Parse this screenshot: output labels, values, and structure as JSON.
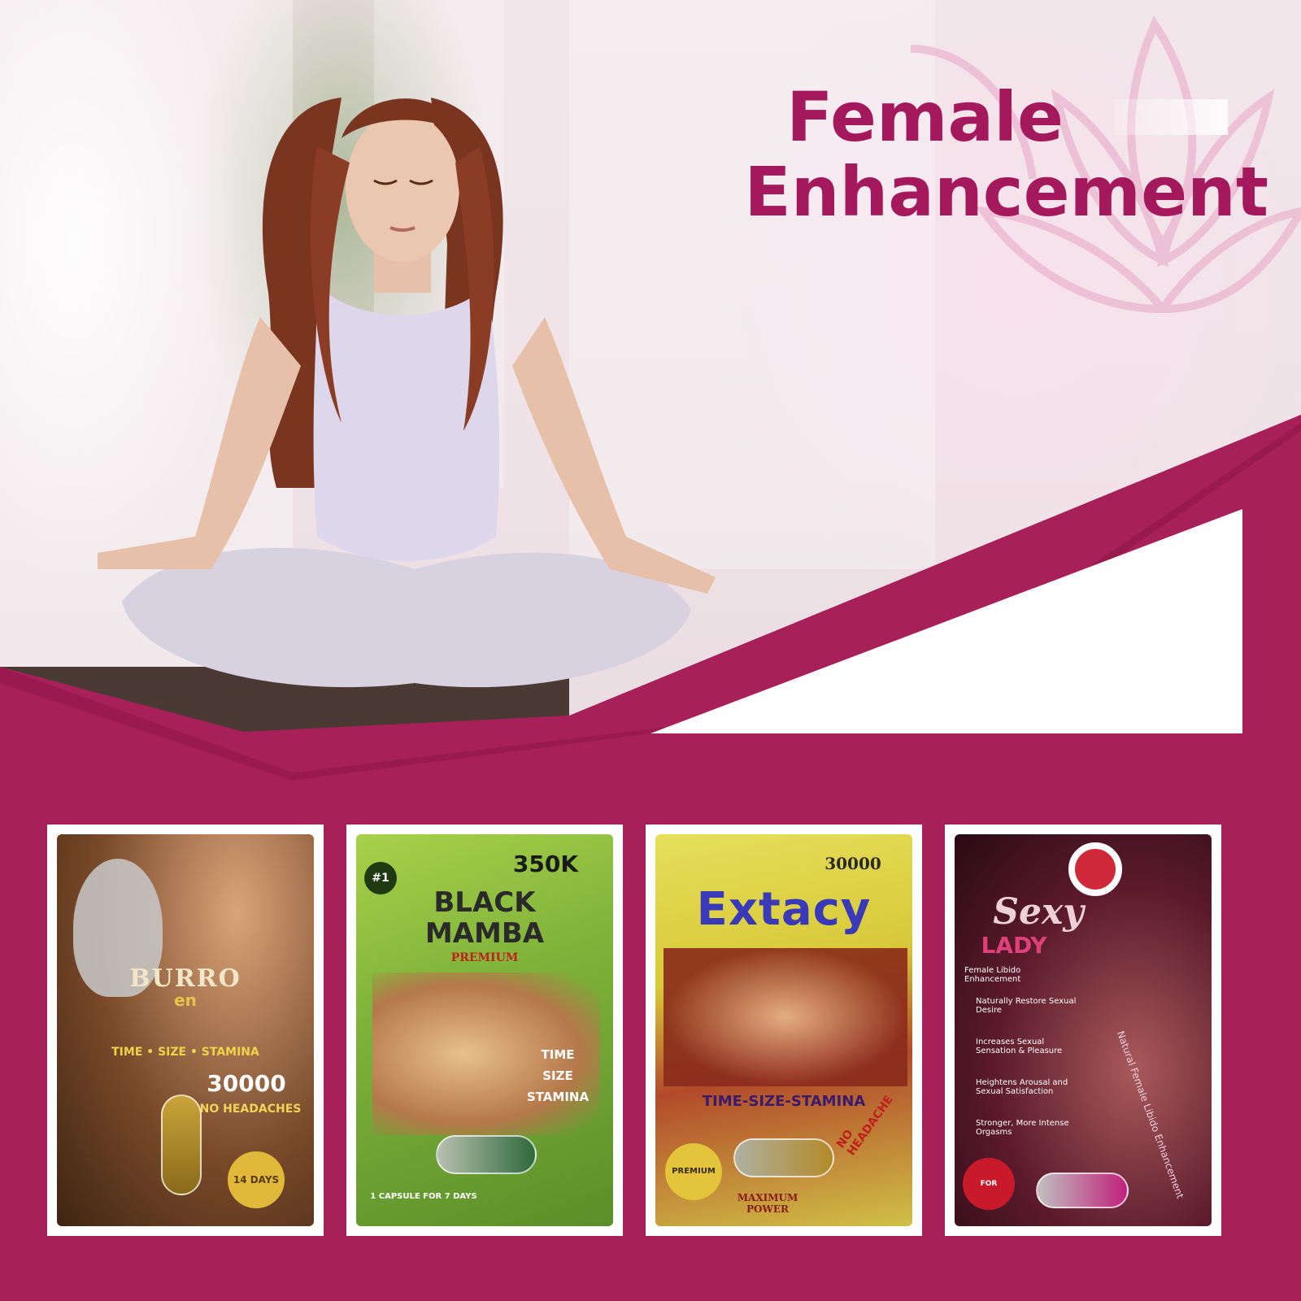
{
  "banner": {
    "title_line1": "Female",
    "title_line2": "Enhancement",
    "accent_color": "#a3195b"
  },
  "products": [
    {
      "name_top": "BURRO",
      "name_mid": "en",
      "tagline": "TIME • SIZE • STAMINA",
      "strength": "30000",
      "claim": "NO HEADACHES",
      "badge": "14 DAYS",
      "theme": "#5a3a22"
    },
    {
      "rank": "#1",
      "strength": "350K",
      "name_line1": "BLACK",
      "name_line2": "MAMBA",
      "variant": "PREMIUM",
      "benefits": [
        "TIME",
        "SIZE",
        "STAMINA"
      ],
      "dosage": "1 CAPSULE FOR 7 DAYS",
      "theme": "#7fb23a"
    },
    {
      "strength": "30000",
      "name": "Extacy",
      "tagline": "TIME-SIZE-STAMINA",
      "badge": "PREMIUM",
      "footer": "MAXIMUM POWER",
      "claim": "NO HEADACHE",
      "theme": "#d8c93a"
    },
    {
      "name_line1": "Sexy",
      "name_line2": "LADY",
      "subtitle": "Female Libido Enhancement",
      "benefits": [
        "Naturally Restore Sexual Desire",
        "Increases Sexual Sensation & Pleasure",
        "Heightens Arousal and Sexual Satisfaction",
        "Stronger, More Intense Orgasms"
      ],
      "side_text": "Natural Female Libido Enhancement",
      "badge": "FOR WOMEN",
      "theme": "#5b1a2c"
    }
  ]
}
